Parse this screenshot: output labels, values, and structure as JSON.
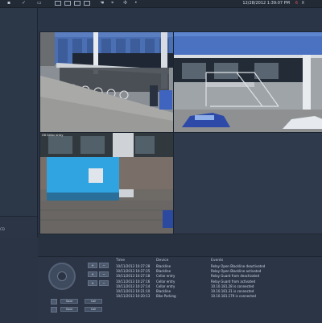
{
  "topbar": {
    "datetime": "12/28/2012 1:39:07 PM",
    "status_count": "6",
    "status_x": "X",
    "icons": [
      "check-icon",
      "grid-1x1-icon",
      "grid-2x2-icon",
      "grid-3x3-icon",
      "grid-4x4-icon",
      "hand-icon",
      "ptz-icon",
      "move-icon",
      "dot-icon"
    ]
  },
  "sidebar": {
    "note": "CD"
  },
  "cameras": {
    "cam3_label": "CB Cellar entry"
  },
  "controls": {
    "btn_plus": "+",
    "btn_minus": "−",
    "wide_buttons": [
      "Save",
      "Call",
      "Save",
      "Call"
    ]
  },
  "events": {
    "headers": {
      "time": "Time",
      "device": "Device",
      "events": "Events"
    },
    "rows": [
      {
        "time": "10/11/2013 10:27:28",
        "device": "Blackline",
        "event": "Relay Open Blackline deactivated"
      },
      {
        "time": "10/11/2013 10:27:25",
        "device": "Blackline",
        "event": "Relay Open Blackline activated"
      },
      {
        "time": "10/11/2013 10:27:18",
        "device": "Cellar entry",
        "event": "Relay Guard from deactivated"
      },
      {
        "time": "10/11/2013 10:27:16",
        "device": "Cellar entry",
        "event": "Relay Guard from activated"
      },
      {
        "time": "10/11/2013 10:27:14",
        "device": "Cellar entry",
        "event": "10.10.181.28 is connected"
      },
      {
        "time": "10/11/2013 10:21:10",
        "device": "Blackline",
        "event": "10.10.181.31 is connected"
      },
      {
        "time": "10/11/2013 10:20:13",
        "device": "Bike Parking",
        "event": "10.10.181.179 is connected"
      }
    ]
  }
}
